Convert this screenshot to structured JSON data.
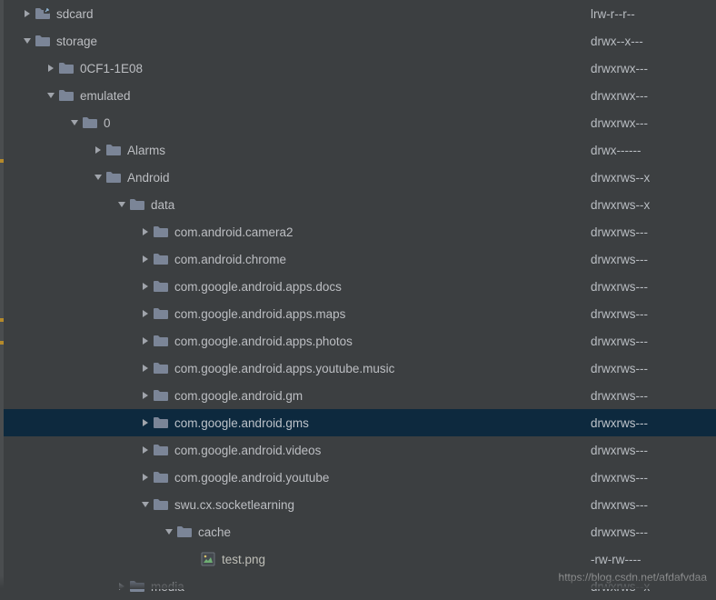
{
  "colors": {
    "folder": "#7b8597",
    "arrow": "#a0a4ab",
    "bg": "#3c3f41",
    "selected": "#0d293e"
  },
  "watermark": "https://blog.csdn.net/afdafvdaa",
  "rows": [
    {
      "indent": 0,
      "arrow": "right",
      "icon": "folder-link",
      "name": "sdcard",
      "perms": "lrw-r--r--"
    },
    {
      "indent": 0,
      "arrow": "down",
      "icon": "folder",
      "name": "storage",
      "perms": "drwx--x---"
    },
    {
      "indent": 1,
      "arrow": "right",
      "icon": "folder",
      "name": "0CF1-1E08",
      "perms": "drwxrwx---"
    },
    {
      "indent": 1,
      "arrow": "down",
      "icon": "folder",
      "name": "emulated",
      "perms": "drwxrwx---"
    },
    {
      "indent": 2,
      "arrow": "down",
      "icon": "folder",
      "name": "0",
      "perms": "drwxrwx---"
    },
    {
      "indent": 3,
      "arrow": "right",
      "icon": "folder",
      "name": "Alarms",
      "perms": "drwx------"
    },
    {
      "indent": 3,
      "arrow": "down",
      "icon": "folder",
      "name": "Android",
      "perms": "drwxrws--x"
    },
    {
      "indent": 4,
      "arrow": "down",
      "icon": "folder",
      "name": "data",
      "perms": "drwxrws--x"
    },
    {
      "indent": 5,
      "arrow": "right",
      "icon": "folder",
      "name": "com.android.camera2",
      "perms": "drwxrws---"
    },
    {
      "indent": 5,
      "arrow": "right",
      "icon": "folder",
      "name": "com.android.chrome",
      "perms": "drwxrws---"
    },
    {
      "indent": 5,
      "arrow": "right",
      "icon": "folder",
      "name": "com.google.android.apps.docs",
      "perms": "drwxrws---"
    },
    {
      "indent": 5,
      "arrow": "right",
      "icon": "folder",
      "name": "com.google.android.apps.maps",
      "perms": "drwxrws---"
    },
    {
      "indent": 5,
      "arrow": "right",
      "icon": "folder",
      "name": "com.google.android.apps.photos",
      "perms": "drwxrws---"
    },
    {
      "indent": 5,
      "arrow": "right",
      "icon": "folder",
      "name": "com.google.android.apps.youtube.music",
      "perms": "drwxrws---"
    },
    {
      "indent": 5,
      "arrow": "right",
      "icon": "folder",
      "name": "com.google.android.gm",
      "perms": "drwxrws---"
    },
    {
      "indent": 5,
      "arrow": "right",
      "icon": "folder",
      "name": "com.google.android.gms",
      "perms": "drwxrws---",
      "selected": true
    },
    {
      "indent": 5,
      "arrow": "right",
      "icon": "folder",
      "name": "com.google.android.videos",
      "perms": "drwxrws---"
    },
    {
      "indent": 5,
      "arrow": "right",
      "icon": "folder",
      "name": "com.google.android.youtube",
      "perms": "drwxrws---"
    },
    {
      "indent": 5,
      "arrow": "down",
      "icon": "folder",
      "name": "swu.cx.socketlearning",
      "perms": "drwxrws---"
    },
    {
      "indent": 6,
      "arrow": "down",
      "icon": "folder",
      "name": "cache",
      "perms": "drwxrws---"
    },
    {
      "indent": 7,
      "arrow": "none",
      "icon": "file-image",
      "name": "test.png",
      "perms": "-rw-rw----"
    },
    {
      "indent": 4,
      "arrow": "right",
      "icon": "folder",
      "name": "media",
      "perms": "drwxrws--x"
    }
  ]
}
